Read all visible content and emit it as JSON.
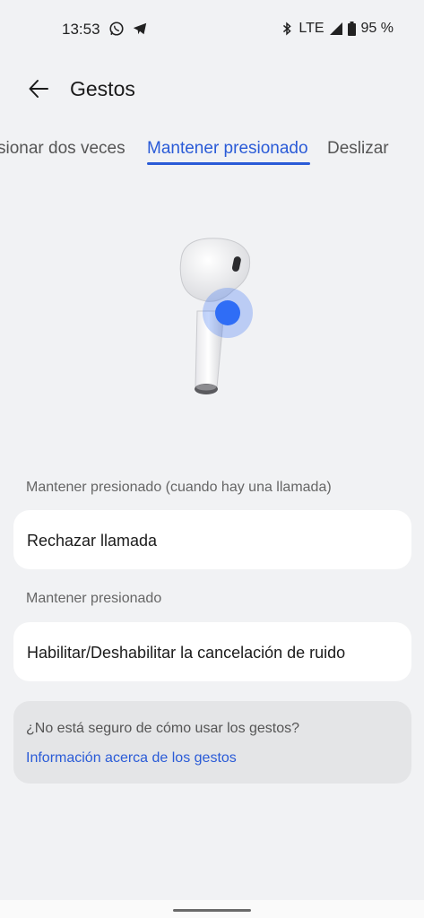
{
  "status_bar": {
    "time": "13:53",
    "left_icons": [
      "whatsapp-icon",
      "telegram-icon"
    ],
    "right_icons": [
      "bluetooth-icon",
      "signal-icon",
      "battery-icon"
    ],
    "network": "LTE",
    "battery": "95 %"
  },
  "header": {
    "title": "Gestos",
    "back_icon": "arrow-back-icon"
  },
  "tabs": [
    {
      "label": "Presionar dos veces",
      "visible_text": "sionar dos veces",
      "active": false
    },
    {
      "label": "Mantener presionado",
      "active": true
    },
    {
      "label": "Deslizar",
      "active": false
    }
  ],
  "illustration": {
    "name": "earbud-illustration",
    "accent": "#2f6df6"
  },
  "sections": [
    {
      "label": "Mantener presionado (cuando hay una llamada)",
      "value": "Rechazar llamada"
    },
    {
      "label": "Mantener presionado",
      "value": "Habilitar/Deshabilitar la cancelación de ruido"
    }
  ],
  "info": {
    "question": "¿No está seguro de cómo usar los gestos?",
    "link": "Información acerca de los gestos"
  },
  "colors": {
    "accent": "#2a5bd7",
    "background": "#f1f2f4",
    "card": "#ffffff"
  }
}
